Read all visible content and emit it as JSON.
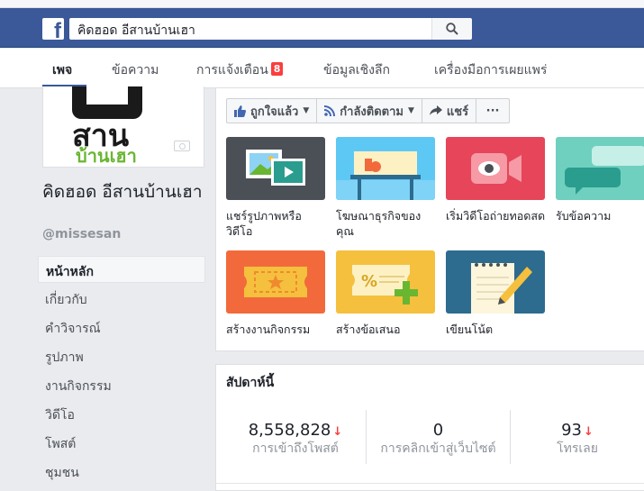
{
  "search": {
    "value": "คิดฮอด อีสานบ้านเฮา"
  },
  "tabs": [
    {
      "label": "เพจ"
    },
    {
      "label": "ข้อความ"
    },
    {
      "label": "การแจ้งเตือน",
      "badge": "8"
    },
    {
      "label": "ข้อมูลเชิงลึก"
    },
    {
      "label": "เครื่องมือการเผยแพร่"
    }
  ],
  "profile": {
    "logo_text_1": "สาน",
    "logo_text_2": "บ้านเฮา",
    "name": "คิดฮอด อีสานบ้านเฮา",
    "handle": "@missesan"
  },
  "sidebar": {
    "items": [
      {
        "label": "หน้าหลัก"
      },
      {
        "label": "เกี่ยวกับ"
      },
      {
        "label": "คำวิจารณ์"
      },
      {
        "label": "รูปภาพ"
      },
      {
        "label": "งานกิจกรรม"
      },
      {
        "label": "วิดีโอ"
      },
      {
        "label": "โพสต์"
      },
      {
        "label": "ชุมชน"
      }
    ]
  },
  "actions": {
    "like": "ถูกใจแล้ว",
    "follow": "กำลังติดตาม",
    "share": "แชร์",
    "more": "···"
  },
  "tiles": [
    {
      "label": "แชร์รูปภาพหรือวิดีโอ",
      "color": "#4b4f56"
    },
    {
      "label": "โฆษณาธุรกิจของคุณ",
      "color": "#4fc3f7"
    },
    {
      "label": "เริ่มวิดีโอถ่ายทอดสด",
      "color": "#e6455a"
    },
    {
      "label": "รับข้อความ",
      "color": "#6fd0bf"
    },
    {
      "label": "สร้างงานกิจกรรม",
      "color": "#f26a3b"
    },
    {
      "label": "สร้างข้อเสนอ",
      "color": "#f5c03d"
    },
    {
      "label": "เขียนโน้ต",
      "color": "#2d6b8f"
    }
  ],
  "week": {
    "title": "สัปดาห์นี้",
    "stats": [
      {
        "value": "8,558,828",
        "label": "การเข้าถึงโพสต์",
        "trend": "down"
      },
      {
        "value": "0",
        "label": "การคลิกเข้าสู่เว็บไซต์",
        "trend": "none"
      },
      {
        "value": "93",
        "label": "โทรเลย",
        "trend": "down"
      }
    ]
  },
  "colors": {
    "brand": "#3b5998",
    "badge": "#fa3e3e"
  }
}
